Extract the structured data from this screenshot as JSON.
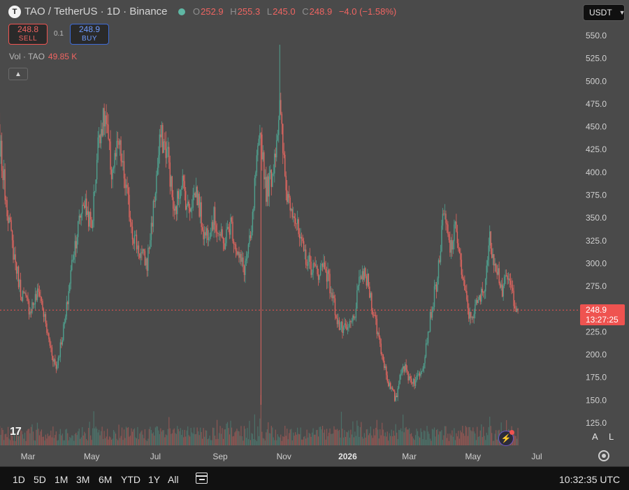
{
  "header": {
    "symbol_logo": "T",
    "title": "TAO / TetherUS · 1D · Binance",
    "ohlc": [
      {
        "key": "O",
        "value": "252.9"
      },
      {
        "key": "H",
        "value": "255.3"
      },
      {
        "key": "L",
        "value": "245.0"
      },
      {
        "key": "C",
        "value": "248.9"
      }
    ],
    "change": "−4.0 (−1.58%)",
    "currency": "USDT"
  },
  "trade": {
    "sell_price": "248.8",
    "sell_label": "SELL",
    "spread": "0.1",
    "buy_price": "248.9",
    "buy_label": "BUY"
  },
  "volume_legend": {
    "label": "Vol · TAO",
    "value": "49.85 K"
  },
  "price_tag": {
    "price": "248.9",
    "countdown": "13:27:25"
  },
  "axis": {
    "auto_label": "A",
    "log_label": "L"
  },
  "bottom_bar": {
    "ranges": [
      "1D",
      "5D",
      "1M",
      "3M",
      "6M",
      "YTD",
      "1Y",
      "All"
    ],
    "clock": "10:32:35 UTC"
  },
  "icons": {
    "logo": "tradingview-logo",
    "collapse": "chevron-up-icon",
    "settings": "gear-icon",
    "date_range": "calendar-icon",
    "alert": "flash-icon"
  },
  "colors": {
    "background": "#4a4a4a",
    "up": "#4fa08e",
    "down": "#e0655f",
    "price_tag": "#ef5350",
    "bottom_bar": "#111111"
  },
  "chart_data": {
    "type": "candlestick",
    "title": "",
    "xlabel": "",
    "ylabel": "",
    "ylim": [
      115,
      560
    ],
    "y_ticks": [
      550,
      525,
      500,
      475,
      450,
      425,
      400,
      375,
      350,
      325,
      300,
      275,
      225,
      200,
      175,
      150,
      125
    ],
    "x_ticks": [
      {
        "label": "Mar",
        "date": "2025-03-01"
      },
      {
        "label": "May",
        "date": "2025-05-01"
      },
      {
        "label": "Jul",
        "date": "2025-07-01"
      },
      {
        "label": "Sep",
        "date": "2025-09-01"
      },
      {
        "label": "Nov",
        "date": "2025-11-01"
      },
      {
        "label": "2026",
        "date": "2026-01-01"
      },
      {
        "label": "Mar",
        "date": "2026-03-01"
      },
      {
        "label": "May",
        "date": "2026-05-01"
      },
      {
        "label": "Jul",
        "date": "2026-07-01"
      }
    ],
    "price_path": [
      {
        "date": "2025-01-25",
        "close": 380
      },
      {
        "date": "2025-02-01",
        "close": 440
      },
      {
        "date": "2025-02-06",
        "close": 390
      },
      {
        "date": "2025-02-14",
        "close": 320
      },
      {
        "date": "2025-02-22",
        "close": 270
      },
      {
        "date": "2025-03-03",
        "close": 250
      },
      {
        "date": "2025-03-12",
        "close": 270
      },
      {
        "date": "2025-03-20",
        "close": 220
      },
      {
        "date": "2025-03-28",
        "close": 185
      },
      {
        "date": "2025-04-06",
        "close": 240
      },
      {
        "date": "2025-04-13",
        "close": 310
      },
      {
        "date": "2025-04-23",
        "close": 370
      },
      {
        "date": "2025-05-01",
        "close": 340
      },
      {
        "date": "2025-05-08",
        "close": 445
      },
      {
        "date": "2025-05-14",
        "close": 460
      },
      {
        "date": "2025-05-20",
        "close": 400
      },
      {
        "date": "2025-05-27",
        "close": 430
      },
      {
        "date": "2025-06-03",
        "close": 380
      },
      {
        "date": "2025-06-10",
        "close": 330
      },
      {
        "date": "2025-06-17",
        "close": 310
      },
      {
        "date": "2025-06-23",
        "close": 300
      },
      {
        "date": "2025-06-29",
        "close": 360
      },
      {
        "date": "2025-07-06",
        "close": 440
      },
      {
        "date": "2025-07-13",
        "close": 420
      },
      {
        "date": "2025-07-19",
        "close": 350
      },
      {
        "date": "2025-07-26",
        "close": 395
      },
      {
        "date": "2025-08-01",
        "close": 360
      },
      {
        "date": "2025-08-09",
        "close": 380
      },
      {
        "date": "2025-08-17",
        "close": 330
      },
      {
        "date": "2025-08-26",
        "close": 350
      },
      {
        "date": "2025-09-04",
        "close": 320
      },
      {
        "date": "2025-09-11",
        "close": 345
      },
      {
        "date": "2025-09-19",
        "close": 305
      },
      {
        "date": "2025-09-24",
        "close": 295
      },
      {
        "date": "2025-10-01",
        "close": 330
      },
      {
        "date": "2025-10-05",
        "close": 400
      },
      {
        "date": "2025-10-10",
        "close": 440
      },
      {
        "date": "2025-10-15",
        "close": 380
      },
      {
        "date": "2025-10-21",
        "close": 400
      },
      {
        "date": "2025-10-28",
        "close": 470
      },
      {
        "date": "2025-11-03",
        "close": 380
      },
      {
        "date": "2025-11-10",
        "close": 360
      },
      {
        "date": "2025-11-17",
        "close": 320
      },
      {
        "date": "2025-11-25",
        "close": 300
      },
      {
        "date": "2025-12-03",
        "close": 290
      },
      {
        "date": "2025-12-10",
        "close": 300
      },
      {
        "date": "2025-12-18",
        "close": 260
      },
      {
        "date": "2025-12-24",
        "close": 230
      },
      {
        "date": "2025-12-31",
        "close": 225
      },
      {
        "date": "2026-01-07",
        "close": 240
      },
      {
        "date": "2026-01-14",
        "close": 290
      },
      {
        "date": "2026-01-20",
        "close": 280
      },
      {
        "date": "2026-01-27",
        "close": 240
      },
      {
        "date": "2026-02-03",
        "close": 200
      },
      {
        "date": "2026-02-10",
        "close": 165
      },
      {
        "date": "2026-02-16",
        "close": 150
      },
      {
        "date": "2026-02-22",
        "close": 190
      },
      {
        "date": "2026-03-01",
        "close": 175
      },
      {
        "date": "2026-03-07",
        "close": 170
      },
      {
        "date": "2026-03-14",
        "close": 190
      },
      {
        "date": "2026-03-21",
        "close": 240
      },
      {
        "date": "2026-03-28",
        "close": 285
      },
      {
        "date": "2026-04-03",
        "close": 355
      },
      {
        "date": "2026-04-09",
        "close": 315
      },
      {
        "date": "2026-04-15",
        "close": 340
      },
      {
        "date": "2026-04-21",
        "close": 280
      },
      {
        "date": "2026-04-28",
        "close": 240
      },
      {
        "date": "2026-05-05",
        "close": 255
      },
      {
        "date": "2026-05-11",
        "close": 270
      },
      {
        "date": "2026-05-17",
        "close": 325
      },
      {
        "date": "2026-05-23",
        "close": 300
      },
      {
        "date": "2026-05-29",
        "close": 270
      },
      {
        "date": "2026-06-03",
        "close": 285
      },
      {
        "date": "2026-06-09",
        "close": 262
      },
      {
        "date": "2026-06-13",
        "close": 249
      }
    ],
    "last_price": 248.9,
    "volume_spikes": [
      {
        "date": "2025-10-10",
        "relative": 0.9
      },
      {
        "date": "2026-04-21",
        "relative": 0.35
      }
    ],
    "grid": false,
    "price_line": 248.9
  }
}
